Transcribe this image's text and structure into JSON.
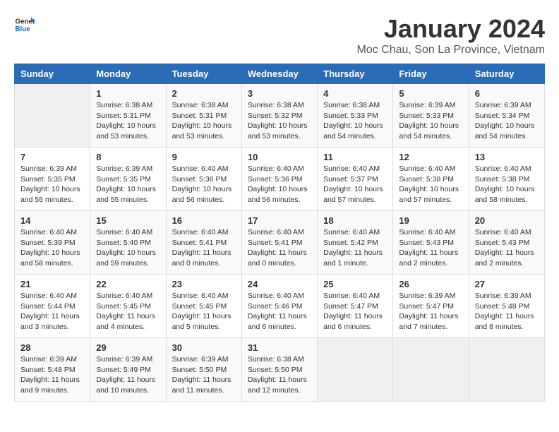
{
  "logo": {
    "general": "General",
    "blue": "Blue"
  },
  "title": "January 2024",
  "subtitle": "Moc Chau, Son La Province, Vietnam",
  "headers": [
    "Sunday",
    "Monday",
    "Tuesday",
    "Wednesday",
    "Thursday",
    "Friday",
    "Saturday"
  ],
  "weeks": [
    [
      {
        "day": "",
        "sunrise": "",
        "sunset": "",
        "daylight": "",
        "empty": true
      },
      {
        "day": "1",
        "sunrise": "Sunrise: 6:38 AM",
        "sunset": "Sunset: 5:31 PM",
        "daylight": "Daylight: 10 hours and 53 minutes.",
        "empty": false
      },
      {
        "day": "2",
        "sunrise": "Sunrise: 6:38 AM",
        "sunset": "Sunset: 5:31 PM",
        "daylight": "Daylight: 10 hours and 53 minutes.",
        "empty": false
      },
      {
        "day": "3",
        "sunrise": "Sunrise: 6:38 AM",
        "sunset": "Sunset: 5:32 PM",
        "daylight": "Daylight: 10 hours and 53 minutes.",
        "empty": false
      },
      {
        "day": "4",
        "sunrise": "Sunrise: 6:38 AM",
        "sunset": "Sunset: 5:33 PM",
        "daylight": "Daylight: 10 hours and 54 minutes.",
        "empty": false
      },
      {
        "day": "5",
        "sunrise": "Sunrise: 6:39 AM",
        "sunset": "Sunset: 5:33 PM",
        "daylight": "Daylight: 10 hours and 54 minutes.",
        "empty": false
      },
      {
        "day": "6",
        "sunrise": "Sunrise: 6:39 AM",
        "sunset": "Sunset: 5:34 PM",
        "daylight": "Daylight: 10 hours and 54 minutes.",
        "empty": false
      }
    ],
    [
      {
        "day": "7",
        "sunrise": "Sunrise: 6:39 AM",
        "sunset": "Sunset: 5:35 PM",
        "daylight": "Daylight: 10 hours and 55 minutes.",
        "empty": false
      },
      {
        "day": "8",
        "sunrise": "Sunrise: 6:39 AM",
        "sunset": "Sunset: 5:35 PM",
        "daylight": "Daylight: 10 hours and 55 minutes.",
        "empty": false
      },
      {
        "day": "9",
        "sunrise": "Sunrise: 6:40 AM",
        "sunset": "Sunset: 5:36 PM",
        "daylight": "Daylight: 10 hours and 56 minutes.",
        "empty": false
      },
      {
        "day": "10",
        "sunrise": "Sunrise: 6:40 AM",
        "sunset": "Sunset: 5:36 PM",
        "daylight": "Daylight: 10 hours and 56 minutes.",
        "empty": false
      },
      {
        "day": "11",
        "sunrise": "Sunrise: 6:40 AM",
        "sunset": "Sunset: 5:37 PM",
        "daylight": "Daylight: 10 hours and 57 minutes.",
        "empty": false
      },
      {
        "day": "12",
        "sunrise": "Sunrise: 6:40 AM",
        "sunset": "Sunset: 5:38 PM",
        "daylight": "Daylight: 10 hours and 57 minutes.",
        "empty": false
      },
      {
        "day": "13",
        "sunrise": "Sunrise: 6:40 AM",
        "sunset": "Sunset: 5:38 PM",
        "daylight": "Daylight: 10 hours and 58 minutes.",
        "empty": false
      }
    ],
    [
      {
        "day": "14",
        "sunrise": "Sunrise: 6:40 AM",
        "sunset": "Sunset: 5:39 PM",
        "daylight": "Daylight: 10 hours and 58 minutes.",
        "empty": false
      },
      {
        "day": "15",
        "sunrise": "Sunrise: 6:40 AM",
        "sunset": "Sunset: 5:40 PM",
        "daylight": "Daylight: 10 hours and 59 minutes.",
        "empty": false
      },
      {
        "day": "16",
        "sunrise": "Sunrise: 6:40 AM",
        "sunset": "Sunset: 5:41 PM",
        "daylight": "Daylight: 11 hours and 0 minutes.",
        "empty": false
      },
      {
        "day": "17",
        "sunrise": "Sunrise: 6:40 AM",
        "sunset": "Sunset: 5:41 PM",
        "daylight": "Daylight: 11 hours and 0 minutes.",
        "empty": false
      },
      {
        "day": "18",
        "sunrise": "Sunrise: 6:40 AM",
        "sunset": "Sunset: 5:42 PM",
        "daylight": "Daylight: 11 hours and 1 minute.",
        "empty": false
      },
      {
        "day": "19",
        "sunrise": "Sunrise: 6:40 AM",
        "sunset": "Sunset: 5:43 PM",
        "daylight": "Daylight: 11 hours and 2 minutes.",
        "empty": false
      },
      {
        "day": "20",
        "sunrise": "Sunrise: 6:40 AM",
        "sunset": "Sunset: 5:43 PM",
        "daylight": "Daylight: 11 hours and 2 minutes.",
        "empty": false
      }
    ],
    [
      {
        "day": "21",
        "sunrise": "Sunrise: 6:40 AM",
        "sunset": "Sunset: 5:44 PM",
        "daylight": "Daylight: 11 hours and 3 minutes.",
        "empty": false
      },
      {
        "day": "22",
        "sunrise": "Sunrise: 6:40 AM",
        "sunset": "Sunset: 5:45 PM",
        "daylight": "Daylight: 11 hours and 4 minutes.",
        "empty": false
      },
      {
        "day": "23",
        "sunrise": "Sunrise: 6:40 AM",
        "sunset": "Sunset: 5:45 PM",
        "daylight": "Daylight: 11 hours and 5 minutes.",
        "empty": false
      },
      {
        "day": "24",
        "sunrise": "Sunrise: 6:40 AM",
        "sunset": "Sunset: 5:46 PM",
        "daylight": "Daylight: 11 hours and 6 minutes.",
        "empty": false
      },
      {
        "day": "25",
        "sunrise": "Sunrise: 6:40 AM",
        "sunset": "Sunset: 5:47 PM",
        "daylight": "Daylight: 11 hours and 6 minutes.",
        "empty": false
      },
      {
        "day": "26",
        "sunrise": "Sunrise: 6:39 AM",
        "sunset": "Sunset: 5:47 PM",
        "daylight": "Daylight: 11 hours and 7 minutes.",
        "empty": false
      },
      {
        "day": "27",
        "sunrise": "Sunrise: 6:39 AM",
        "sunset": "Sunset: 5:48 PM",
        "daylight": "Daylight: 11 hours and 8 minutes.",
        "empty": false
      }
    ],
    [
      {
        "day": "28",
        "sunrise": "Sunrise: 6:39 AM",
        "sunset": "Sunset: 5:48 PM",
        "daylight": "Daylight: 11 hours and 9 minutes.",
        "empty": false
      },
      {
        "day": "29",
        "sunrise": "Sunrise: 6:39 AM",
        "sunset": "Sunset: 5:49 PM",
        "daylight": "Daylight: 11 hours and 10 minutes.",
        "empty": false
      },
      {
        "day": "30",
        "sunrise": "Sunrise: 6:39 AM",
        "sunset": "Sunset: 5:50 PM",
        "daylight": "Daylight: 11 hours and 11 minutes.",
        "empty": false
      },
      {
        "day": "31",
        "sunrise": "Sunrise: 6:38 AM",
        "sunset": "Sunset: 5:50 PM",
        "daylight": "Daylight: 11 hours and 12 minutes.",
        "empty": false
      },
      {
        "day": "",
        "sunrise": "",
        "sunset": "",
        "daylight": "",
        "empty": true
      },
      {
        "day": "",
        "sunrise": "",
        "sunset": "",
        "daylight": "",
        "empty": true
      },
      {
        "day": "",
        "sunrise": "",
        "sunset": "",
        "daylight": "",
        "empty": true
      }
    ]
  ]
}
